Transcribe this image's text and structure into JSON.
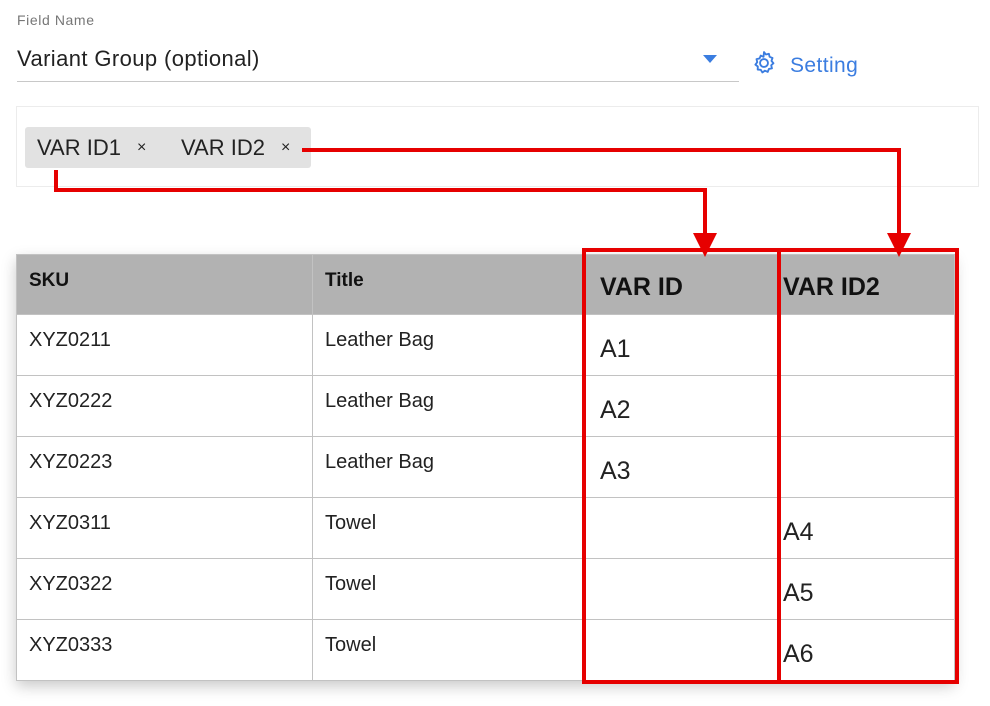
{
  "field": {
    "label": "Field Name",
    "value": "Variant Group (optional)"
  },
  "setting": {
    "label": "Setting"
  },
  "tags": [
    {
      "label": "VAR ID1",
      "remove": "×"
    },
    {
      "label": "VAR ID2",
      "remove": "×"
    }
  ],
  "table": {
    "headers": [
      "SKU",
      "Title",
      "VAR ID",
      "VAR ID2"
    ],
    "rows": [
      [
        "XYZ0211",
        "Leather Bag",
        "A1",
        ""
      ],
      [
        "XYZ0222",
        "Leather Bag",
        "A2",
        ""
      ],
      [
        "XYZ0223",
        "Leather Bag",
        "A3",
        ""
      ],
      [
        "XYZ0311",
        "Towel",
        "",
        "A4"
      ],
      [
        "XYZ0322",
        "Towel",
        "",
        "A5"
      ],
      [
        "XYZ0333",
        "Towel",
        "",
        "A6"
      ]
    ]
  },
  "colors": {
    "accent": "#3b7de0",
    "highlight": "#e60000",
    "header_bg": "#b2b2b2",
    "tag_bg": "#e2e2e2"
  },
  "icons": {
    "setting": "gear-icon",
    "dropdown": "caret-down-icon",
    "remove": "close-icon"
  }
}
